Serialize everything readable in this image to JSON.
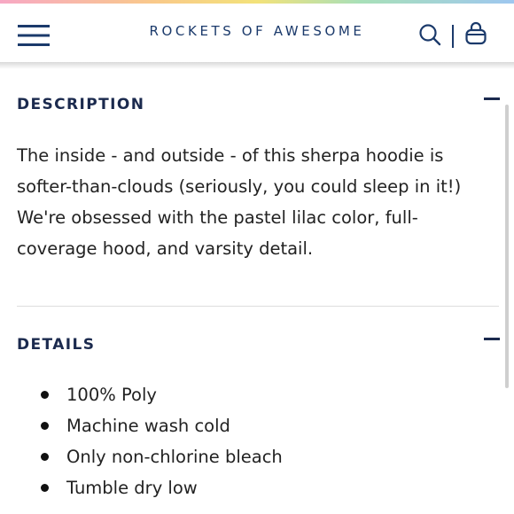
{
  "header": {
    "brand": "ROCKETS OF AWESOME",
    "menu_icon": "hamburger-menu-icon",
    "search_icon": "search-icon",
    "bag_icon": "shopping-bag-icon"
  },
  "description": {
    "title": "DESCRIPTION",
    "toggle_icon": "minus-icon",
    "text": "The inside - and outside - of this sherpa hoodie is softer-than-clouds (seriously, you could sleep in it!) We're obsessed with the pastel lilac color, full-coverage hood, and varsity detail."
  },
  "details": {
    "title": "DETAILS",
    "toggle_icon": "minus-icon",
    "items": [
      "100% Poly",
      "Machine wash cold",
      "Only non-chlorine bleach",
      "Tumble dry low"
    ]
  },
  "colors": {
    "brand_navy": "#1b3a6b",
    "heading": "#1b2a4e",
    "body_text": "#222222"
  }
}
